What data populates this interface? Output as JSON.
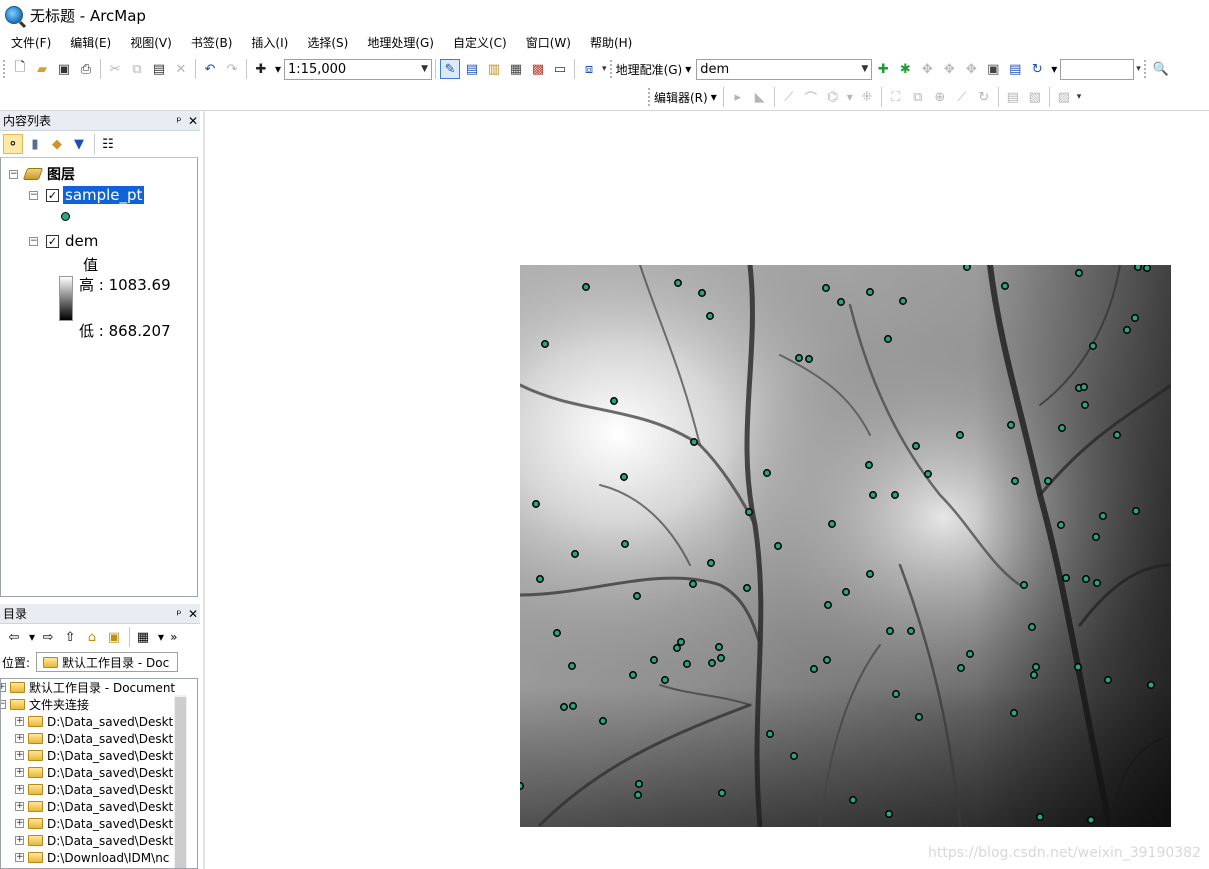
{
  "window": {
    "title": "无标题 - ArcMap"
  },
  "menu": [
    "文件(F)",
    "编辑(E)",
    "视图(V)",
    "书签(B)",
    "插入(I)",
    "选择(S)",
    "地理处理(G)",
    "自定义(C)",
    "窗口(W)",
    "帮助(H)"
  ],
  "toolbar": {
    "scale": "1:15,000",
    "georef_label": "地理配准(G)",
    "georef_layer": "dem",
    "editor_label": "编辑器(R)"
  },
  "toc": {
    "title": "内容列表",
    "root": "图层",
    "layers": [
      {
        "name": "sample_pt"
      },
      {
        "name": "dem",
        "legend_title": "值",
        "high": "高 : 1083.69",
        "low": "低 : 868.207"
      }
    ]
  },
  "catalog": {
    "title": "目录",
    "location_label": "位置:",
    "location_value": "默认工作目录 - Doc",
    "items": [
      "默认工作目录 - Document",
      "文件夹连接",
      "D:\\Data_saved\\Deskt",
      "D:\\Data_saved\\Deskt",
      "D:\\Data_saved\\Deskt",
      "D:\\Data_saved\\Deskt",
      "D:\\Data_saved\\Deskt",
      "D:\\Data_saved\\Deskt",
      "D:\\Data_saved\\Deskt",
      "D:\\Data_saved\\Deskt",
      "D:\\Download\\IDM\\nc"
    ]
  },
  "map": {
    "watermark": "https://blog.csdn.net/weixin_39190382",
    "dem_colors": {
      "high": "#ffffff",
      "low": "#000000"
    },
    "point_color": "#27a878"
  }
}
